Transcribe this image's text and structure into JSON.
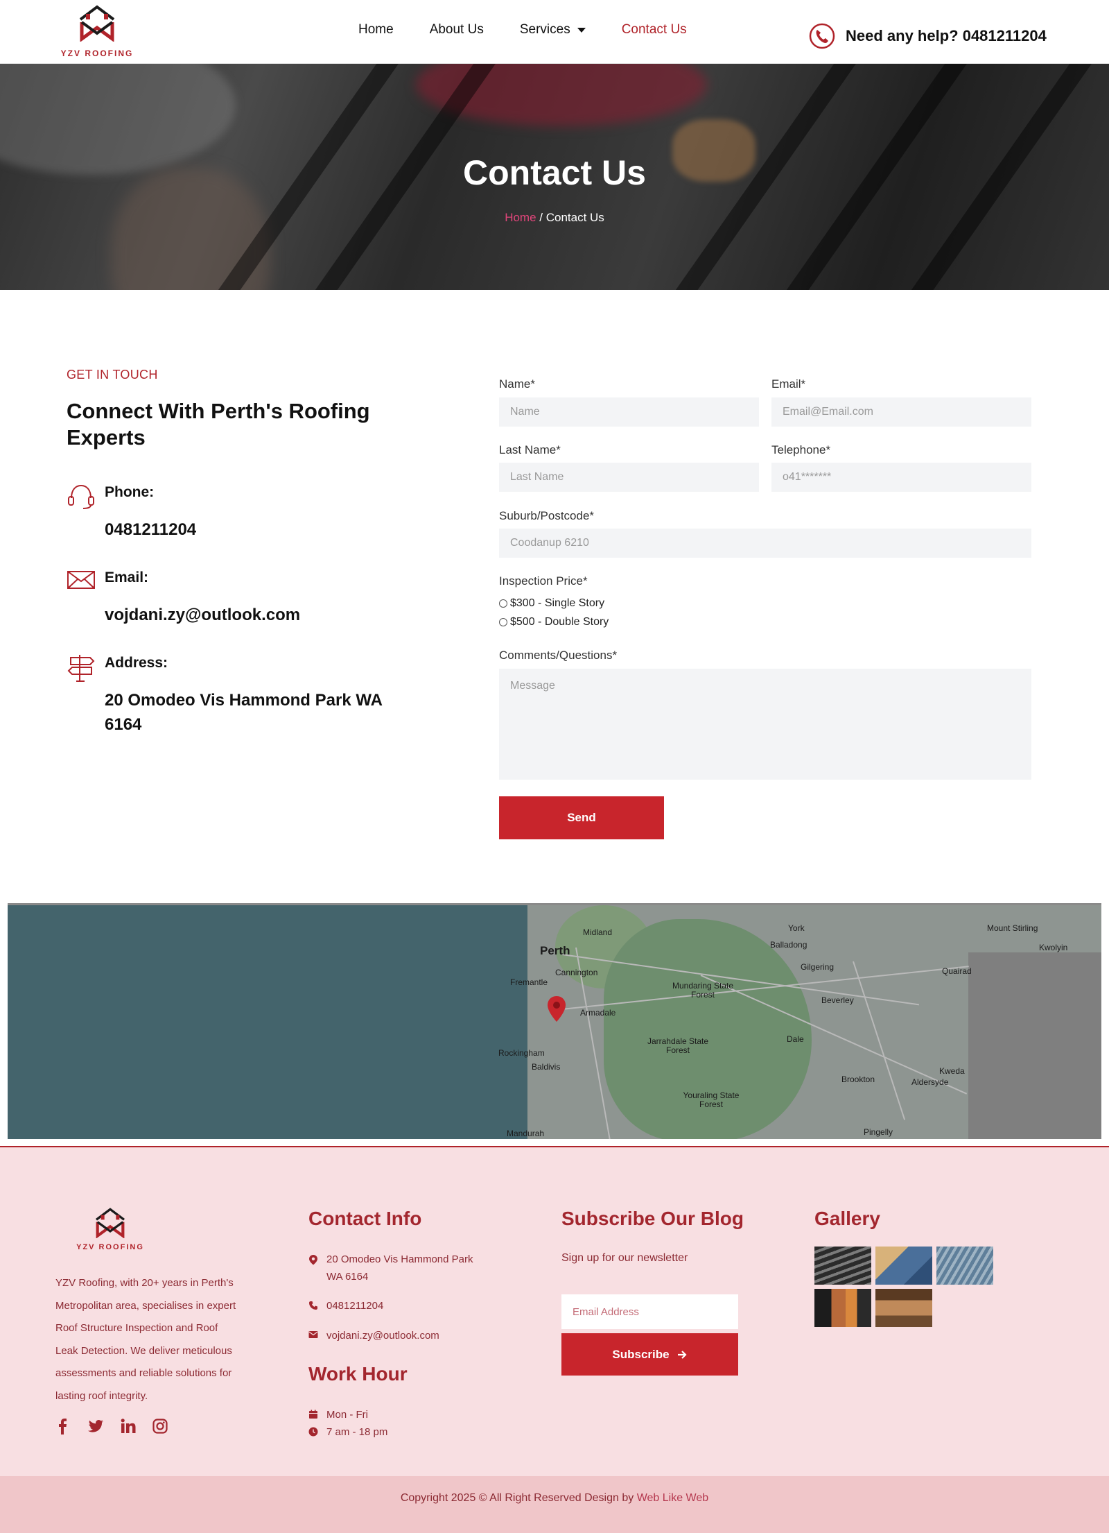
{
  "brand": {
    "name": "YZV ROOFING",
    "accent": "#c8252c",
    "dark_red": "#b0232a"
  },
  "nav": {
    "items": [
      {
        "label": "Home"
      },
      {
        "label": "About Us"
      },
      {
        "label": "Services"
      },
      {
        "label": "Contact Us"
      }
    ],
    "help_text": "Need any help? 0481211204"
  },
  "hero": {
    "title": "Contact Us",
    "breadcrumb": {
      "home": "Home",
      "separator": " / ",
      "current": "Contact Us"
    }
  },
  "contact": {
    "eyebrow": "GET IN TOUCH",
    "title": "Connect With Perth's Roofing Experts",
    "phone": {
      "label": "Phone:",
      "value": "0481211204",
      "icon": "headset-icon"
    },
    "email": {
      "label": "Email:",
      "value": "vojdani.zy@outlook.com",
      "icon": "envelope-icon"
    },
    "address": {
      "label": "Address:",
      "value": "20 Omodeo Vis Hammond Park WA 6164",
      "icon": "signpost-icon"
    }
  },
  "form": {
    "name": {
      "label": "Name*",
      "placeholder": "Name"
    },
    "email": {
      "label": "Email*",
      "placeholder": "Email@Email.com"
    },
    "last_name": {
      "label": "Last Name*",
      "placeholder": "Last Name"
    },
    "telephone": {
      "label": "Telephone*",
      "placeholder": "o41*******"
    },
    "suburb": {
      "label": "Suburb/Postcode*",
      "placeholder": "Coodanup 6210"
    },
    "inspection": {
      "label": "Inspection Price*",
      "options": [
        "$300 - Single Story",
        "$500 - Double Story"
      ]
    },
    "comments": {
      "label": "Comments/Questions*",
      "placeholder": "Message"
    },
    "submit": "Send"
  },
  "map": {
    "labels": [
      "Perth",
      "Midland",
      "York",
      "Mount Stirling",
      "Kwolyin",
      "Balladong",
      "Quairad",
      "Fremantle",
      "Cannington",
      "Mundaring State Forest",
      "Gilgering",
      "Beverley",
      "Armadale",
      "Jarrahdale State Forest",
      "Dale",
      "Rockingham",
      "Baldivis",
      "Brookton",
      "Kweda",
      "Aldersyde",
      "Youraling State Forest",
      "Mandurah",
      "Pingelly"
    ]
  },
  "footer": {
    "about": "YZV Roofing, with 20+ years in Perth's Metropolitan area, specialises in expert Roof Structure Inspection and Roof Leak Detection. We deliver meticulous assessments and reliable solutions for lasting roof integrity.",
    "social_icons": [
      "facebook-icon",
      "twitter-icon",
      "linkedin-icon",
      "instagram-icon"
    ],
    "contact_info": {
      "title": "Contact Info",
      "address": "20 Omodeo Vis Hammond Park WA 6164",
      "phone": "0481211204",
      "email": "vojdani.zy@outlook.com"
    },
    "work_hour": {
      "title": "Work Hour",
      "days": "Mon - Fri",
      "hours": "7 am - 18 pm"
    },
    "subscribe": {
      "title": "Subscribe Our Blog",
      "subtitle": "Sign up for our newsletter",
      "placeholder": "Email Address",
      "button": "Subscribe"
    },
    "gallery": {
      "title": "Gallery"
    },
    "copyright": "Copyright 2025 © All Right Reserved Design by ",
    "copyright_link": "Web Like Web"
  }
}
